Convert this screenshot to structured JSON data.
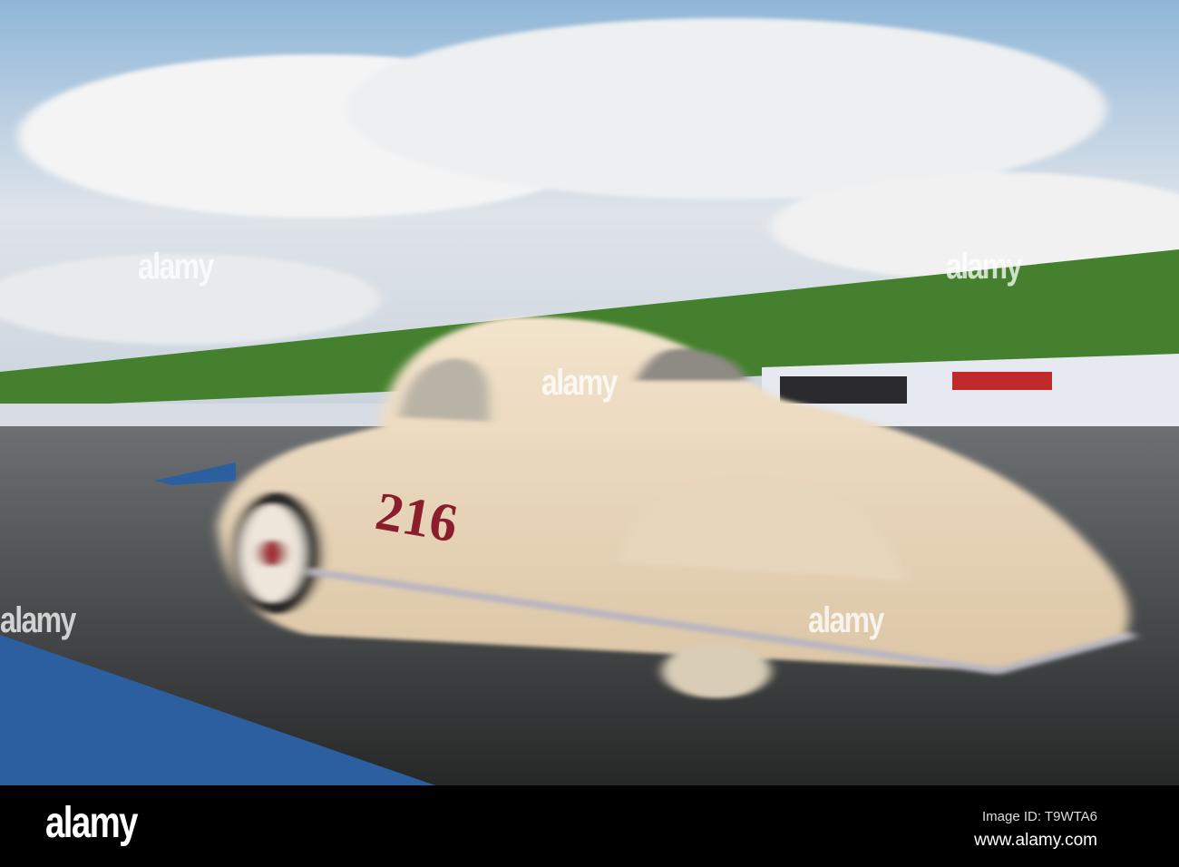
{
  "photo": {
    "car_number": "216",
    "watermark_text": "alamy",
    "colors": {
      "car": "#eedcc2",
      "number": "#8a1e2c",
      "sky": "#9fc2de",
      "grass": "#3f7a2c",
      "track": "#3a3c3e",
      "lane": "#2c5fa0"
    }
  },
  "footer": {
    "logo": "alamy",
    "image_id": "Image ID: T9WTA6",
    "url": "www.alamy.com"
  }
}
